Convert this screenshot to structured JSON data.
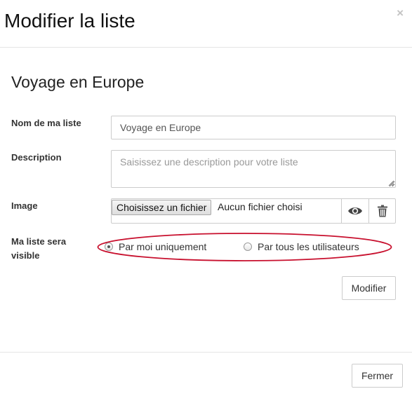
{
  "modal": {
    "title": "Modifier la liste",
    "close_symbol": "×"
  },
  "list": {
    "heading": "Voyage en Europe"
  },
  "form": {
    "name": {
      "label": "Nom de ma liste",
      "value": "Voyage en Europe"
    },
    "description": {
      "label": "Description",
      "value": "",
      "placeholder": "Saisissez une description pour votre liste"
    },
    "image": {
      "label": "Image",
      "file_button": "Choisissez un fichier",
      "file_status": "Aucun fichier choisi",
      "preview_icon": "eye-icon",
      "delete_icon": "trash-icon"
    },
    "visibility": {
      "label": "Ma liste sera visible",
      "options": [
        {
          "label": "Par moi uniquement",
          "selected": true
        },
        {
          "label": "Par tous les utilisateurs",
          "selected": false
        }
      ],
      "highlight_color": "#c8102e"
    },
    "submit_label": "Modifier"
  },
  "footer": {
    "close_label": "Fermer"
  }
}
